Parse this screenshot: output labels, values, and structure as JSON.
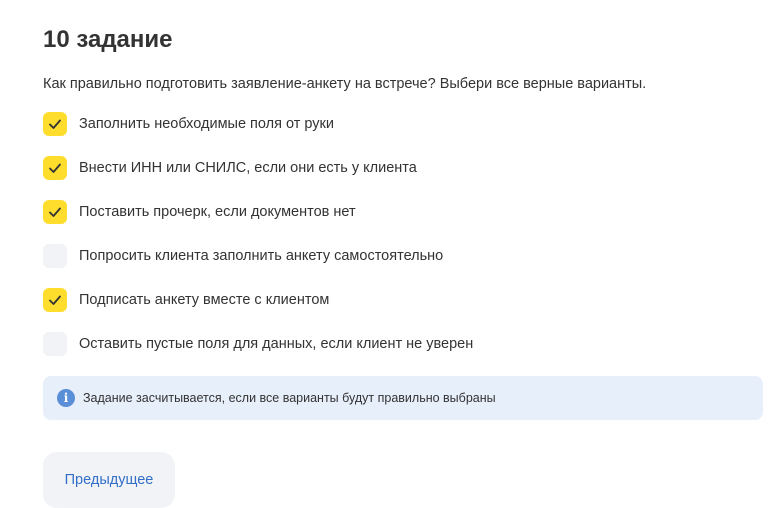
{
  "task": {
    "title": "10 задание",
    "question": "Как правильно подготовить заявление-анкету на встрече? Выбери все верные варианты."
  },
  "options": [
    {
      "label": "Заполнить необходимые поля от руки",
      "checked": true
    },
    {
      "label": "Внести ИНН или СНИЛС, если они есть у клиента",
      "checked": true
    },
    {
      "label": "Поставить прочерк, если документов нет",
      "checked": true
    },
    {
      "label": "Попросить клиента заполнить анкету самостоятельно",
      "checked": false
    },
    {
      "label": "Подписать анкету вместе с клиентом",
      "checked": true
    },
    {
      "label": "Оставить пустые поля для данных, если клиент не уверен",
      "checked": false
    }
  ],
  "info": {
    "icon": "info-icon",
    "text": "Задание засчитывается, если все варианты будут правильно выбраны"
  },
  "navigation": {
    "previous_label": "Предыдущее"
  },
  "colors": {
    "checked_bg": "#ffdd2d",
    "unchecked_bg": "#f1f3f6",
    "info_bg": "#e7effb",
    "link_blue": "#336fc8"
  }
}
